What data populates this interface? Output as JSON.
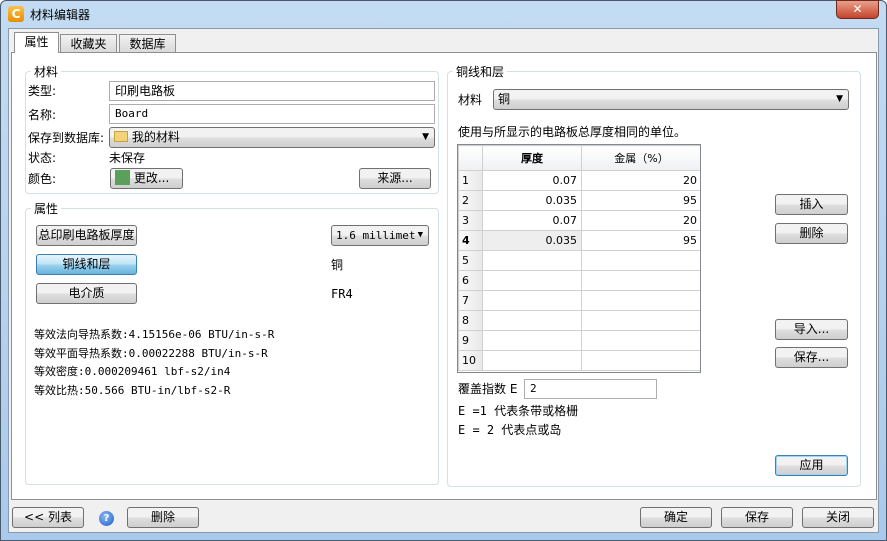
{
  "window": {
    "title": "材料编辑器",
    "close": "✕"
  },
  "tabs": [
    "属性",
    "收藏夹",
    "数据库"
  ],
  "material": {
    "group_label": "材料",
    "type_label": "类型:",
    "type_value": "印刷电路板",
    "name_label": "名称:",
    "name_value": "Board",
    "save_db_label": "保存到数据库:",
    "save_db_value": "我的材料",
    "status_label": "状态:",
    "status_value": "未保存",
    "color_label": "颜色:",
    "color_button": "更改...",
    "color_swatch": "#5aa05a",
    "source_button": "来源..."
  },
  "properties": {
    "group_label": "属性",
    "thickness_button": "总印刷电路板厚度",
    "thickness_value": "1.6 millimet",
    "copper_button": "铜线和层",
    "copper_value": "铜",
    "dielectric_button": "电介质",
    "dielectric_value": "FR4",
    "lines": [
      "等效法向导热系数:4.15156e-06 BTU/in-s-R",
      "等效平面导热系数:0.00022288 BTU/in-s-R",
      "等效密度:0.000209461 lbf-s2/in4",
      "等效比热:50.566 BTU-in/lbf-s2-R"
    ]
  },
  "copper": {
    "group_label": "铜线和层",
    "material_label": "材料",
    "material_value": "铜",
    "hint": "使用与所显示的电路板总厚度相同的单位。",
    "columns": [
      "",
      "厚度",
      "金属（%）"
    ],
    "rows": [
      [
        "1",
        "0.07",
        "20"
      ],
      [
        "2",
        "0.035",
        "95"
      ],
      [
        "3",
        "0.07",
        "20"
      ],
      [
        "4",
        "0.035",
        "95"
      ],
      [
        "5",
        "",
        ""
      ],
      [
        "6",
        "",
        ""
      ],
      [
        "7",
        "",
        ""
      ],
      [
        "8",
        "",
        ""
      ],
      [
        "9",
        "",
        ""
      ],
      [
        "10",
        "",
        ""
      ]
    ],
    "insert": "插入",
    "delete": "删除",
    "import": "导入...",
    "save": "保存...",
    "coverage_label": "覆盖指数 E",
    "coverage_value": "2",
    "note1": "E =1 代表条带或格栅",
    "note2": "E = 2 代表点或岛",
    "apply": "应用"
  },
  "footer": {
    "list": "<< 列表",
    "help": "?",
    "delete": "删除",
    "ok": "确定",
    "save": "保存",
    "close": "关闭"
  }
}
